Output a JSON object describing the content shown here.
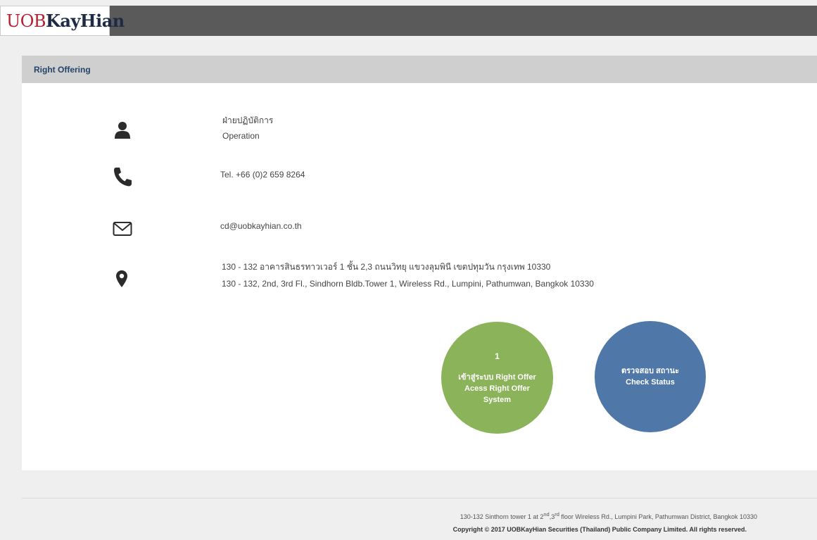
{
  "brand": {
    "logo_uob": "UOB",
    "logo_kayhian": "KayHian"
  },
  "panel": {
    "title": "Right Offering"
  },
  "contact": {
    "department_th": "ฝ่ายปฏิบัติการ",
    "department_en": "Operation",
    "phone": "Tel. +66 (0)2 659 8264",
    "email": "cd@uobkayhian.co.th",
    "address_th": "130 - 132 อาคารสินธรทาวเวอร์ 1 ชั้น 2,3 ถนนวิทยุ แขวงลุมพินี เขตปทุมวัน กรุงเทพ 10330",
    "address_en": "130 - 132, 2nd, 3rd Fl., Sindhorn Bldb.Tower 1, Wireless Rd., Lumpini, Pathumwan, Bangkok 10330"
  },
  "actions": {
    "access": {
      "number": "1",
      "line_th": "เข้าสู่ระบบ Right Offer",
      "line_en1": "Acess Right Offer",
      "line_en2": "System",
      "color": "#8ab35a"
    },
    "status": {
      "line_th": "ตรวจสอบ สถานะ",
      "line_en": "Check Status",
      "color": "#4f78a8"
    }
  },
  "footer": {
    "address_pre": "130-132 Sinthorn tower 1 at 2",
    "sup1": "nd",
    "mid": ",3",
    "sup2": "rd",
    "address_post": " floor Wireless Rd., Lumpini Park, Pathumwan District, Bangkok 10330",
    "copyright": "Copyright © 2017 UOBKayHian Securities (Thailand) Public Company Limited. All rights reserved."
  },
  "colors": {
    "header": "#5a5a5a",
    "panel_title_bg": "#cfcfcf",
    "panel_title_text": "#21456a",
    "icon": "#2b2b2b"
  }
}
